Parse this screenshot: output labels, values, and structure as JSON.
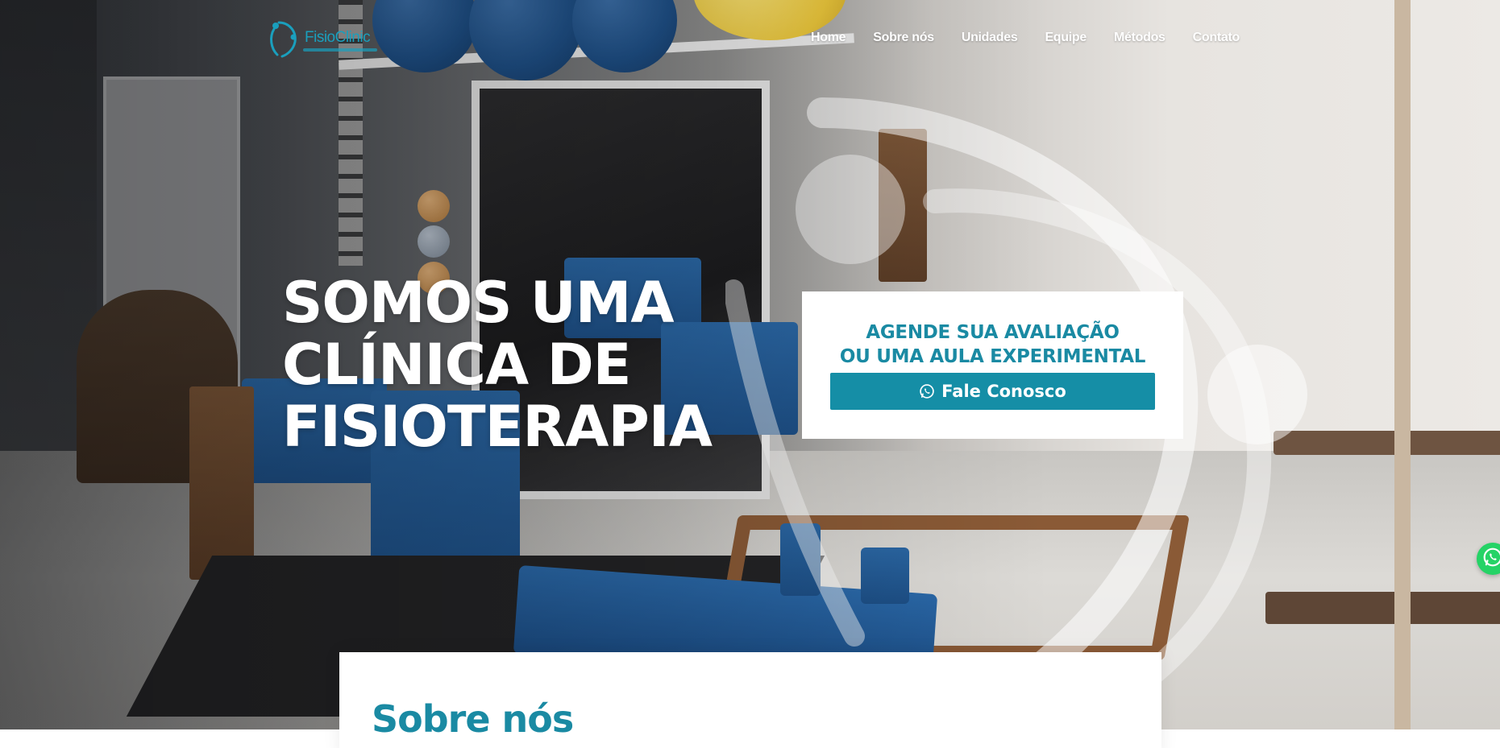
{
  "brand": {
    "logo_text": "FisioClinic",
    "accent_color": "#1a8aa3",
    "button_color": "#158ea6",
    "whatsapp_color": "#25d366"
  },
  "nav": {
    "items": [
      {
        "label": "Home"
      },
      {
        "label": "Sobre nós"
      },
      {
        "label": "Unidades"
      },
      {
        "label": "Equipe"
      },
      {
        "label": "Métodos"
      },
      {
        "label": "Contato"
      }
    ]
  },
  "hero": {
    "title_lines": [
      "SOMOS UMA",
      "CLÍNICA DE",
      "FISIOTERAPIA"
    ]
  },
  "cta": {
    "line1": "AGENDE SUA AVALIAÇÃO",
    "line2": "OU UMA AULA EXPERIMENTAL",
    "button_label": "Fale Conosco",
    "button_icon": "whatsapp-icon"
  },
  "about": {
    "title": "Sobre nós"
  },
  "floating": {
    "icon": "whatsapp-icon"
  }
}
